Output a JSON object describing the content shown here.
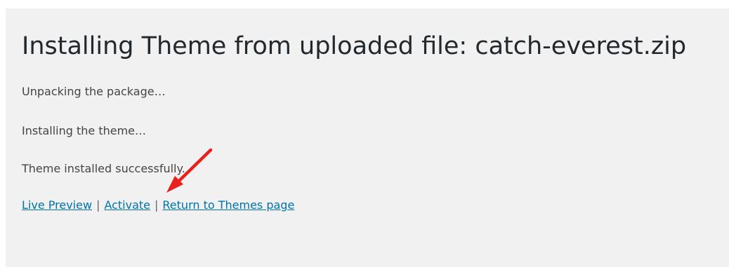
{
  "page": {
    "title": "Installing Theme from uploaded file: catch-everest.zip",
    "steps": [
      "Unpacking the package…",
      "Installing the theme…",
      "Theme installed successfully."
    ],
    "actions": {
      "live_preview": "Live Preview",
      "separator": "|",
      "activate": "Activate",
      "return_to_themes": "Return to Themes page"
    }
  },
  "annotation": {
    "arrow_color": "#e8211c",
    "arrow_target": "Activate"
  }
}
